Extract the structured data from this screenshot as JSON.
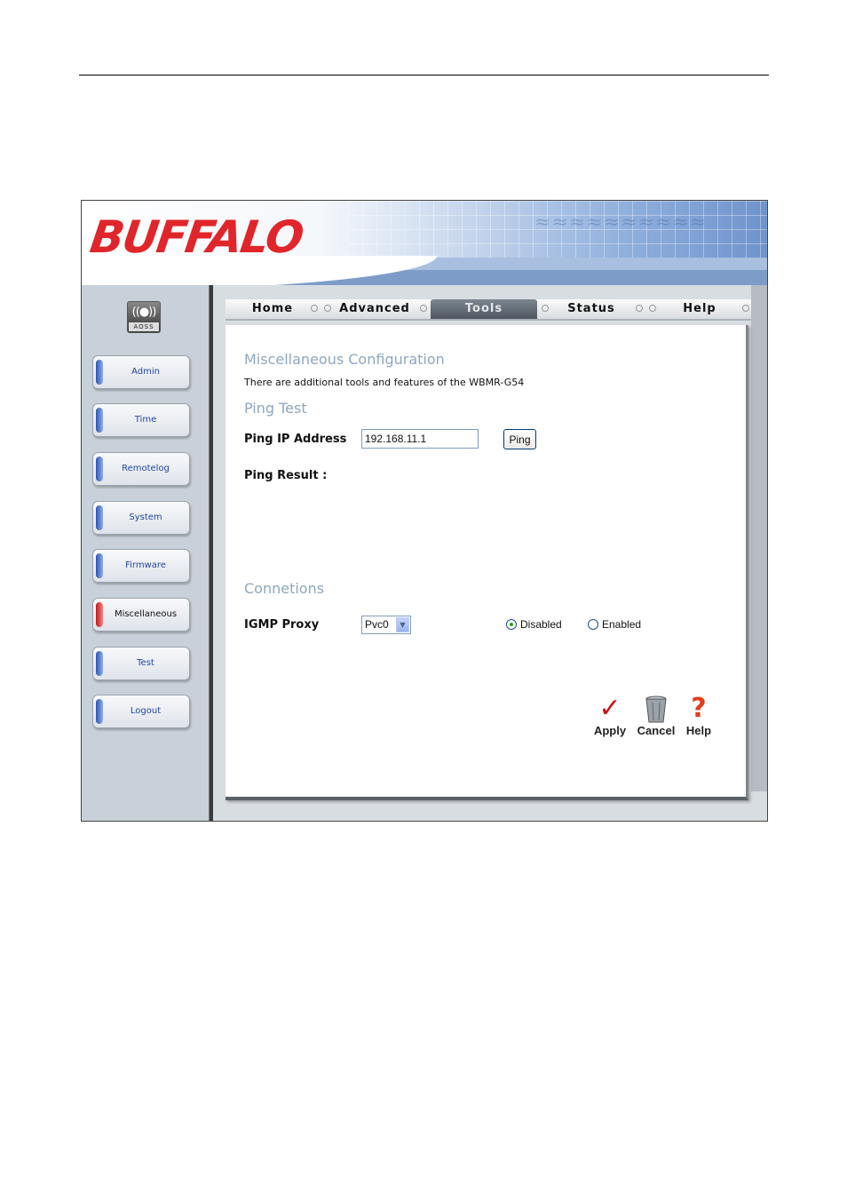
{
  "header": {
    "logo_text": "BUFFALO"
  },
  "sidebar": {
    "aoss_label": "AOSS",
    "items": [
      {
        "label": "Admin",
        "active": false
      },
      {
        "label": "Time",
        "active": false
      },
      {
        "label": "Remotelog",
        "active": false
      },
      {
        "label": "System",
        "active": false
      },
      {
        "label": "Firmware",
        "active": false
      },
      {
        "label": "Miscellaneous",
        "active": true
      },
      {
        "label": "Test",
        "active": false
      },
      {
        "label": "Logout",
        "active": false
      }
    ]
  },
  "tabs": [
    {
      "label": "Home",
      "active": false
    },
    {
      "label": "Advanced",
      "active": false
    },
    {
      "label": "Tools",
      "active": true
    },
    {
      "label": "Status",
      "active": false
    },
    {
      "label": "Help",
      "active": false
    }
  ],
  "content": {
    "misc_title": "Miscellaneous Configuration",
    "misc_desc": "There are additional tools and features of the WBMR-G54",
    "ping_title": "Ping Test",
    "ping_ip_label": "Ping IP Address",
    "ping_ip_value": "192.168.11.1",
    "ping_button": "Ping",
    "ping_result_label": "Ping Result :",
    "conn_title": "Connetions",
    "igmp_label": "IGMP Proxy",
    "igmp_select_value": "Pvc0",
    "radio_disabled": "Disabled",
    "radio_enabled": "Enabled",
    "igmp_selected": "Disabled"
  },
  "actions": {
    "apply": "Apply",
    "cancel": "Cancel",
    "help": "Help"
  },
  "colors": {
    "brand_red": "#e0262a",
    "section_title": "#8ea7c0",
    "side_link": "#2246a6"
  }
}
